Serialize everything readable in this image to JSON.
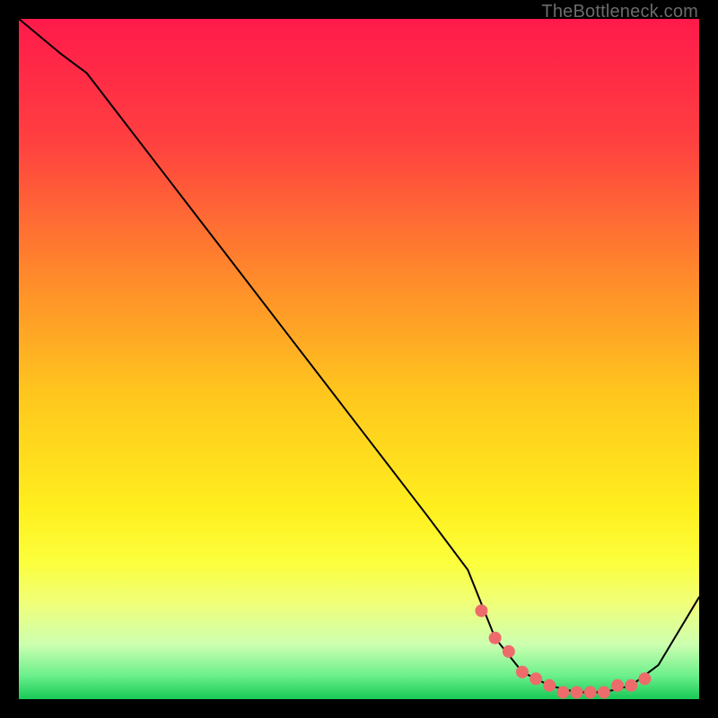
{
  "watermark": "TheBottleneck.com",
  "chart_data": {
    "type": "line",
    "title": "",
    "xlabel": "",
    "ylabel": "",
    "xlim": [
      0,
      100
    ],
    "ylim": [
      0,
      100
    ],
    "grid": false,
    "legend": false,
    "series": [
      {
        "name": "bottleneck-curve",
        "color": "#000000",
        "x": [
          0,
          6,
          10,
          20,
          30,
          40,
          50,
          60,
          66,
          70,
          74,
          78,
          82,
          86,
          90,
          94,
          100
        ],
        "values": [
          100,
          95,
          92,
          79,
          66,
          53,
          40,
          27,
          19,
          9,
          4,
          2,
          1,
          1,
          2,
          5,
          15
        ]
      }
    ],
    "highlight_points": {
      "color": "#ee6b6b",
      "radius": 7,
      "x": [
        68,
        70,
        72,
        74,
        76,
        78,
        80,
        82,
        84,
        86,
        88,
        90,
        92
      ],
      "values": [
        13,
        9,
        7,
        4,
        3,
        2,
        1,
        1,
        1,
        1,
        2,
        2,
        3
      ]
    },
    "gradient_stops": [
      {
        "offset": 0,
        "color": "#ff1a4b"
      },
      {
        "offset": 0.18,
        "color": "#ff4040"
      },
      {
        "offset": 0.38,
        "color": "#ff8a2b"
      },
      {
        "offset": 0.55,
        "color": "#ffc61e"
      },
      {
        "offset": 0.72,
        "color": "#ffef1e"
      },
      {
        "offset": 0.8,
        "color": "#fbff3d"
      },
      {
        "offset": 0.86,
        "color": "#f0ff7a"
      },
      {
        "offset": 0.92,
        "color": "#ccffb0"
      },
      {
        "offset": 0.965,
        "color": "#6cf08c"
      },
      {
        "offset": 1.0,
        "color": "#18c956"
      }
    ]
  }
}
